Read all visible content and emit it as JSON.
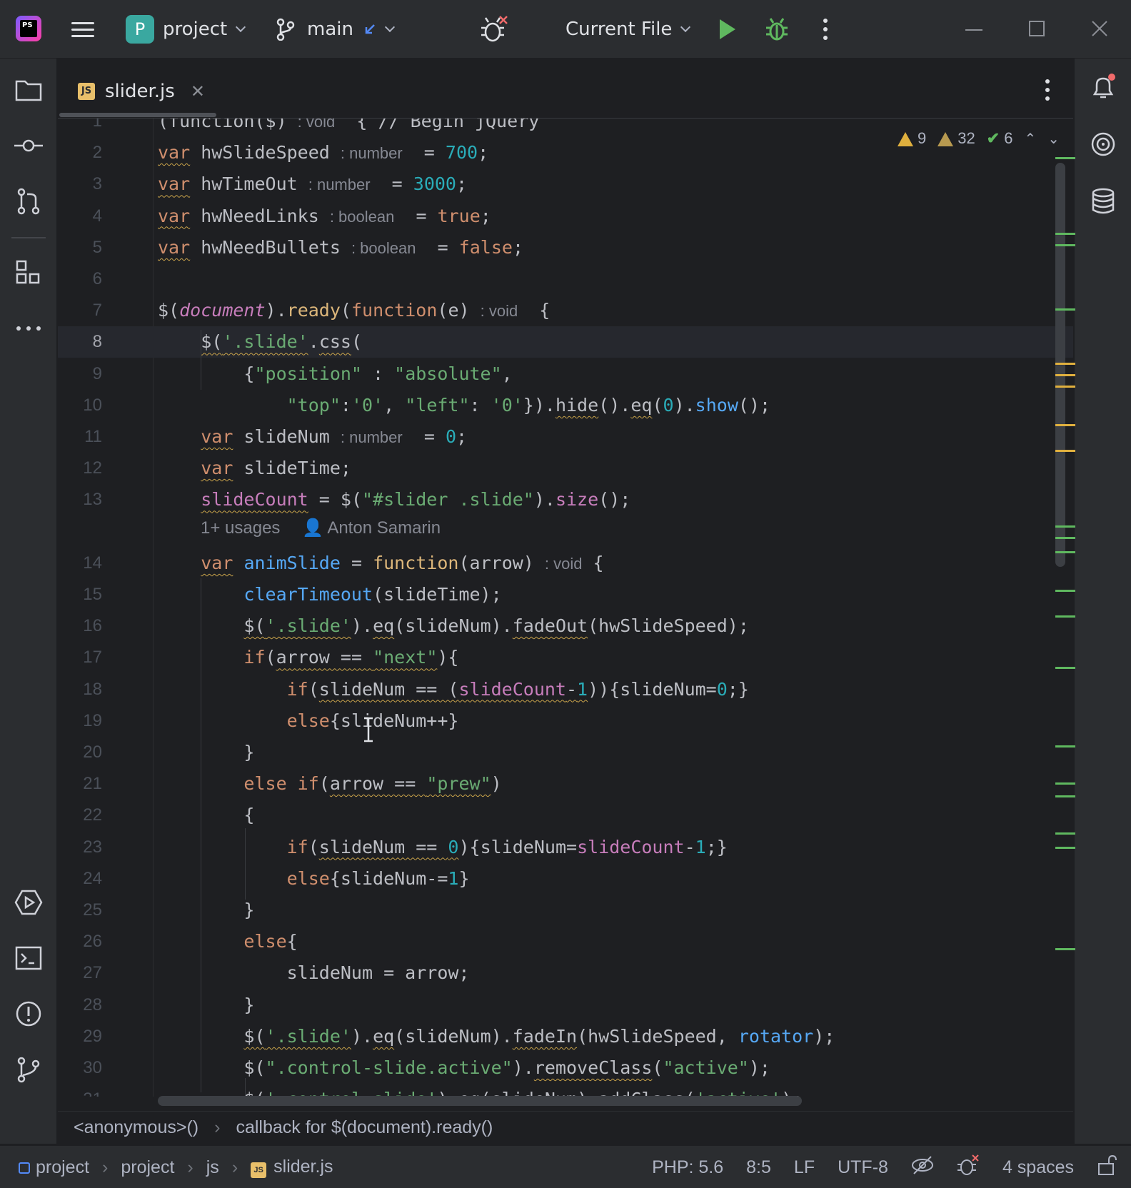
{
  "titlebar": {
    "project_badge": "P",
    "project_name": "project",
    "branch": "main",
    "run_config": "Current File"
  },
  "tab": {
    "label": "slider.js",
    "icon_text": "JS"
  },
  "inspections": {
    "warnings": "9",
    "weak_warnings": "32",
    "ok": "6"
  },
  "code_lines": [
    {
      "n": "1",
      "segs": [
        [
          "dim",
          "(function($) "
        ],
        [
          "inlay",
          ": void"
        ],
        [
          "dim",
          "  { // Begin jQuery"
        ]
      ]
    },
    {
      "n": "2",
      "segs": [
        [
          "kw wv",
          "var"
        ],
        [
          "dim",
          " hwSlideSpeed "
        ],
        [
          "inlay",
          ": number"
        ],
        [
          "dim",
          "  = "
        ],
        [
          "num",
          "700"
        ],
        [
          "dim",
          ";"
        ]
      ]
    },
    {
      "n": "3",
      "segs": [
        [
          "kw wv",
          "var"
        ],
        [
          "dim",
          " hwTimeOut "
        ],
        [
          "inlay",
          ": number"
        ],
        [
          "dim",
          "  = "
        ],
        [
          "num",
          "3000"
        ],
        [
          "dim",
          ";"
        ]
      ]
    },
    {
      "n": "4",
      "segs": [
        [
          "kw wv",
          "var"
        ],
        [
          "dim",
          " hwNeedLinks "
        ],
        [
          "inlay",
          ": boolean"
        ],
        [
          "dim",
          "  = "
        ],
        [
          "kw",
          "true"
        ],
        [
          "dim",
          ";"
        ]
      ]
    },
    {
      "n": "5",
      "segs": [
        [
          "kw wv",
          "var"
        ],
        [
          "dim",
          " hwNeedBullets "
        ],
        [
          "inlay",
          ": boolean"
        ],
        [
          "dim",
          "  = "
        ],
        [
          "kw",
          "false"
        ],
        [
          "dim",
          ";"
        ]
      ]
    },
    {
      "n": "6",
      "segs": []
    },
    {
      "n": "7",
      "segs": [
        [
          "dim",
          "$("
        ],
        [
          "glob",
          "document"
        ],
        [
          "dim",
          ")."
        ],
        [
          "mth",
          "ready"
        ],
        [
          "dim",
          "("
        ],
        [
          "kw",
          "function"
        ],
        [
          "dim",
          "(e) "
        ],
        [
          "inlay",
          ": void"
        ],
        [
          "dim",
          "  {"
        ]
      ]
    },
    {
      "n": "8",
      "segs": [
        [
          "dim",
          "    "
        ],
        [
          "dim wv",
          "$("
        ],
        [
          "str wv",
          "'.slide'"
        ],
        [
          "dim",
          "."
        ],
        [
          "dim wv",
          "css"
        ],
        [
          "dim",
          "("
        ]
      ]
    },
    {
      "n": "9",
      "segs": [
        [
          "dim",
          "        {"
        ],
        [
          "str",
          "\"position\""
        ],
        [
          "dim",
          " : "
        ],
        [
          "str",
          "\"absolute\""
        ],
        [
          "dim",
          ","
        ]
      ]
    },
    {
      "n": "10",
      "segs": [
        [
          "dim",
          "            "
        ],
        [
          "str",
          "\"top\""
        ],
        [
          "dim",
          ":"
        ],
        [
          "str",
          "'0'"
        ],
        [
          "dim",
          ", "
        ],
        [
          "str",
          "\"left\""
        ],
        [
          "dim",
          ": "
        ],
        [
          "str",
          "'0'"
        ],
        [
          "dim",
          "})."
        ],
        [
          "dim wv",
          "hide"
        ],
        [
          "dim",
          "()."
        ],
        [
          "dim wv",
          "eq"
        ],
        [
          "dim",
          "("
        ],
        [
          "num",
          "0"
        ],
        [
          "dim",
          ")."
        ],
        [
          "fn",
          "show"
        ],
        [
          "dim",
          "();"
        ]
      ]
    },
    {
      "n": "11",
      "segs": [
        [
          "dim",
          "    "
        ],
        [
          "kw wv",
          "var"
        ],
        [
          "dim",
          " slideNum "
        ],
        [
          "inlay",
          ": number"
        ],
        [
          "dim",
          "  = "
        ],
        [
          "num",
          "0"
        ],
        [
          "dim",
          ";"
        ]
      ]
    },
    {
      "n": "12",
      "segs": [
        [
          "dim",
          "    "
        ],
        [
          "kw wv",
          "var"
        ],
        [
          "dim",
          " slideTime;"
        ]
      ]
    },
    {
      "n": "13",
      "segs": [
        [
          "dim",
          "    "
        ],
        [
          "pl wv",
          "slideCount"
        ],
        [
          "dim",
          " = $("
        ],
        [
          "str",
          "\"#slider .slide\""
        ],
        [
          "dim",
          ")."
        ],
        [
          "pl",
          "size"
        ],
        [
          "dim",
          "();"
        ]
      ]
    },
    {
      "n": "14",
      "segs": [
        [
          "dim",
          "    "
        ],
        [
          "kw wv",
          "var"
        ],
        [
          "dim",
          " "
        ],
        [
          "fn",
          "animSlide"
        ],
        [
          "dim",
          " = "
        ],
        [
          "mth",
          "function"
        ],
        [
          "dim",
          "(arrow) "
        ],
        [
          "inlay",
          ": void"
        ],
        [
          "dim",
          " {"
        ]
      ]
    },
    {
      "n": "15",
      "segs": [
        [
          "dim",
          "        "
        ],
        [
          "fn",
          "clearTimeout"
        ],
        [
          "dim",
          "(slideTime);"
        ]
      ]
    },
    {
      "n": "16",
      "segs": [
        [
          "dim",
          "        "
        ],
        [
          "dim wv",
          "$("
        ],
        [
          "str wv",
          "'.slide'"
        ],
        [
          "dim",
          ")."
        ],
        [
          "dim wv",
          "eq"
        ],
        [
          "dim",
          "(slideNum)."
        ],
        [
          "dim wv",
          "fadeOut"
        ],
        [
          "dim",
          "(hwSlideSpeed);"
        ]
      ]
    },
    {
      "n": "17",
      "segs": [
        [
          "dim",
          "        "
        ],
        [
          "kw",
          "if"
        ],
        [
          "dim",
          "("
        ],
        [
          "dim wv",
          "arrow == "
        ],
        [
          "str wv",
          "\"next\""
        ],
        [
          "dim",
          "){"
        ]
      ]
    },
    {
      "n": "18",
      "segs": [
        [
          "dim",
          "            "
        ],
        [
          "kw",
          "if"
        ],
        [
          "dim",
          "("
        ],
        [
          "dim wv",
          "slideNum == ("
        ],
        [
          "pl wv",
          "slideCount"
        ],
        [
          "dim wv",
          "-"
        ],
        [
          "num wv",
          "1"
        ],
        [
          "dim",
          "))"
        ],
        [
          "dim",
          "{slideNum="
        ],
        [
          "num",
          "0"
        ],
        [
          "dim",
          ";}"
        ]
      ]
    },
    {
      "n": "19",
      "segs": [
        [
          "dim",
          "            "
        ],
        [
          "kw",
          "else"
        ],
        [
          "dim",
          "{slideNum++}"
        ]
      ]
    },
    {
      "n": "20",
      "segs": [
        [
          "dim",
          "        }"
        ]
      ]
    },
    {
      "n": "21",
      "segs": [
        [
          "dim",
          "        "
        ],
        [
          "kw",
          "else if"
        ],
        [
          "dim",
          "("
        ],
        [
          "dim wv",
          "arrow == "
        ],
        [
          "str wv",
          "\"prew\""
        ],
        [
          "dim",
          ")"
        ]
      ]
    },
    {
      "n": "22",
      "segs": [
        [
          "dim",
          "        {"
        ]
      ]
    },
    {
      "n": "23",
      "segs": [
        [
          "dim",
          "            "
        ],
        [
          "kw",
          "if"
        ],
        [
          "dim",
          "("
        ],
        [
          "dim wv",
          "slideNum == "
        ],
        [
          "num wv",
          "0"
        ],
        [
          "dim",
          "){slideNum="
        ],
        [
          "pl",
          "slideCount"
        ],
        [
          "dim",
          "-"
        ],
        [
          "num",
          "1"
        ],
        [
          "dim",
          ";}"
        ]
      ]
    },
    {
      "n": "24",
      "segs": [
        [
          "dim",
          "            "
        ],
        [
          "kw",
          "else"
        ],
        [
          "dim",
          "{slideNum-="
        ],
        [
          "num",
          "1"
        ],
        [
          "dim",
          "}"
        ]
      ]
    },
    {
      "n": "25",
      "segs": [
        [
          "dim",
          "        }"
        ]
      ]
    },
    {
      "n": "26",
      "segs": [
        [
          "dim",
          "        "
        ],
        [
          "kw",
          "else"
        ],
        [
          "dim",
          "{"
        ]
      ]
    },
    {
      "n": "27",
      "segs": [
        [
          "dim",
          "            slideNum = arrow;"
        ]
      ]
    },
    {
      "n": "28",
      "segs": [
        [
          "dim",
          "        }"
        ]
      ]
    },
    {
      "n": "29",
      "segs": [
        [
          "dim",
          "        "
        ],
        [
          "dim wv",
          "$("
        ],
        [
          "str wv",
          "'.slide'"
        ],
        [
          "dim",
          ")."
        ],
        [
          "dim wv",
          "eq"
        ],
        [
          "dim",
          "(slideNum)."
        ],
        [
          "dim wv",
          "fadeIn"
        ],
        [
          "dim",
          "(hwSlideSpeed, "
        ],
        [
          "fn",
          "rotator"
        ],
        [
          "dim",
          ");"
        ]
      ]
    },
    {
      "n": "30",
      "segs": [
        [
          "dim",
          "        $("
        ],
        [
          "str",
          "\".control-slide.active\""
        ],
        [
          "dim",
          ")."
        ],
        [
          "dim wv",
          "removeClass"
        ],
        [
          "dim",
          "("
        ],
        [
          "str",
          "\"active\""
        ],
        [
          "dim",
          ");"
        ]
      ]
    },
    {
      "n": "31",
      "segs": [
        [
          "dim",
          "        "
        ],
        [
          "dim wv",
          "$("
        ],
        [
          "str wv",
          "'.control-slide'"
        ],
        [
          "dim",
          ")."
        ],
        [
          "dim wv",
          "eq"
        ],
        [
          "dim",
          "(slideNum)."
        ],
        [
          "dim wv",
          "addClass"
        ],
        [
          "dim",
          "("
        ],
        [
          "str",
          "'active'"
        ],
        [
          "dim",
          ");"
        ]
      ]
    }
  ],
  "code_hint": {
    "usages": "1+ usages",
    "author": "Anton Samarin"
  },
  "breadcrumbs": [
    "<anonymous>()",
    "callback for $(document).ready()"
  ],
  "status": {
    "path": [
      "project",
      "project",
      "js",
      "slider.js"
    ],
    "php": "PHP: 5.6",
    "position": "8:5",
    "line_sep": "LF",
    "encoding": "UTF-8",
    "indent": "4 spaces"
  },
  "colors": {
    "accent": "#548af7",
    "warning": "#e0b03e",
    "ok": "#5fb85f",
    "keyword": "#cf8e6d",
    "string": "#6aab73",
    "number": "#2aacb8"
  }
}
